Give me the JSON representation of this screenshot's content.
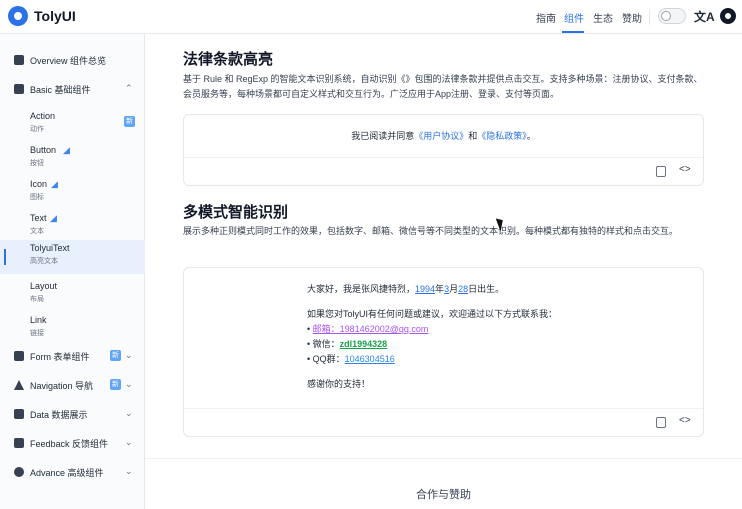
{
  "header": {
    "brand": "TolyUI",
    "nav": [
      "指南",
      "组件",
      "生态",
      "赞助"
    ],
    "active_nav": "组件"
  },
  "sidebar": {
    "groups": [
      {
        "label": "Overview 组件总览",
        "icon": "grid-icon"
      },
      {
        "label": "Basic 基础组件",
        "icon": "basic-icon",
        "expanded": true
      },
      {
        "label": "Form 表单组件",
        "icon": "form-icon",
        "badge": "新"
      },
      {
        "label": "Navigation 导航",
        "icon": "navigation-icon",
        "badge": "新"
      },
      {
        "label": "Data 数据展示",
        "icon": "data-icon"
      },
      {
        "label": "Feedback 反馈组件",
        "icon": "feedback-icon"
      },
      {
        "label": "Advance 高级组件",
        "icon": "advance-icon"
      }
    ],
    "basic_items": [
      {
        "name": "Action",
        "zh": "动作",
        "badge": "新"
      },
      {
        "name": "Button",
        "zh": "按钮",
        "flutter": true
      },
      {
        "name": "Icon",
        "zh": "图标",
        "flutter": true
      },
      {
        "name": "Text",
        "zh": "文本",
        "flutter": true
      },
      {
        "name": "TolyuiText",
        "zh": "高亮文本",
        "active": true
      },
      {
        "name": "Layout",
        "zh": "布局"
      },
      {
        "name": "Link",
        "zh": "链接"
      }
    ],
    "flutter_icon": "flutter-icon",
    "chevron_up": "⌃",
    "chevron_down": "⌄"
  },
  "section1": {
    "title": "法律条款高亮",
    "desc": "基于 Rule 和 RegExp 的智能文本识别系统，自动识别《》包围的法律条款并提供点击交互。支持多种场景：注册协议、支付条款、会员服务等，每种场景都可自定义样式和交互行为。广泛应用于App注册、登录、支付等页面。",
    "line_prefix": "我已阅读并同意",
    "link1": "《用户协议》",
    "line_mid": "和",
    "link2": "《隐私政策》",
    "line_suffix": "。"
  },
  "section2": {
    "title": "多模式智能识别",
    "desc": "展示多种正则模式同时工作的效果，包括数字、邮箱、微信号等不同类型的文本识别。每种模式都有独特的样式和点击交互。",
    "line1_prefix": "大家好，我是张风捷特烈，",
    "year": "1994",
    "year_unit": "年",
    "month": "3",
    "month_unit": "月",
    "day": "28",
    "line1_suffix": "日出生。",
    "line2": "如果您对TolyUI有任何问题或建议，欢迎通过以下方式联系我：",
    "email_label": "• ",
    "email": "邮箱：1981462002@qq.com",
    "wechat_label": "• 微信：",
    "wechat": "zdl1994328",
    "qq_label": "• QQ群：",
    "qq": "1046304516",
    "thanks": "感谢你的支持！"
  },
  "footer": {
    "title": "合作与赞助"
  },
  "card_actions": {
    "copy_icon": "copy-icon",
    "code_icon": "code-icon",
    "code_glyph": "<>"
  }
}
